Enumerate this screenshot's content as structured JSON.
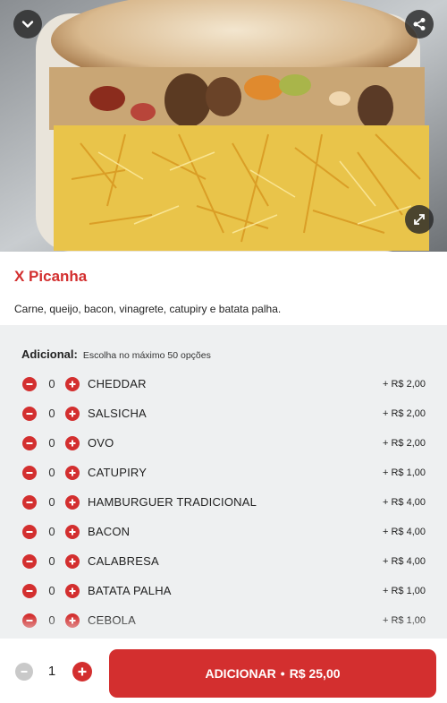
{
  "product": {
    "title": "X Picanha",
    "description": "Carne, queijo, bacon, vinagrete, catupiry e batata palha."
  },
  "hero": {
    "collapse_icon": "chevron-down-icon",
    "share_icon": "share-icon",
    "expand_icon": "expand-icon"
  },
  "addons": {
    "label": "Adicional:",
    "hint": "Escolha no máximo 50 opções",
    "items": [
      {
        "name": "CHEDDAR",
        "qty": "0",
        "price": "+ R$ 2,00"
      },
      {
        "name": "SALSICHA",
        "qty": "0",
        "price": "+ R$ 2,00"
      },
      {
        "name": "OVO",
        "qty": "0",
        "price": "+ R$ 2,00"
      },
      {
        "name": "CATUPIRY",
        "qty": "0",
        "price": "+ R$ 1,00"
      },
      {
        "name": "HAMBURGUER TRADICIONAL",
        "qty": "0",
        "price": "+ R$ 4,00"
      },
      {
        "name": "BACON",
        "qty": "0",
        "price": "+ R$ 4,00"
      },
      {
        "name": "CALABRESA",
        "qty": "0",
        "price": "+ R$ 4,00"
      },
      {
        "name": "BATATA PALHA",
        "qty": "0",
        "price": "+ R$ 1,00"
      },
      {
        "name": "CEBOLA",
        "qty": "0",
        "price": "+ R$ 1,00"
      }
    ]
  },
  "footer": {
    "quantity": "1",
    "add_label": "ADICIONAR",
    "separator": "•",
    "total": "R$ 25,00"
  },
  "colors": {
    "accent": "#d32f2f",
    "addons_bg": "#eef0f1",
    "disabled": "#c9c9c9"
  }
}
